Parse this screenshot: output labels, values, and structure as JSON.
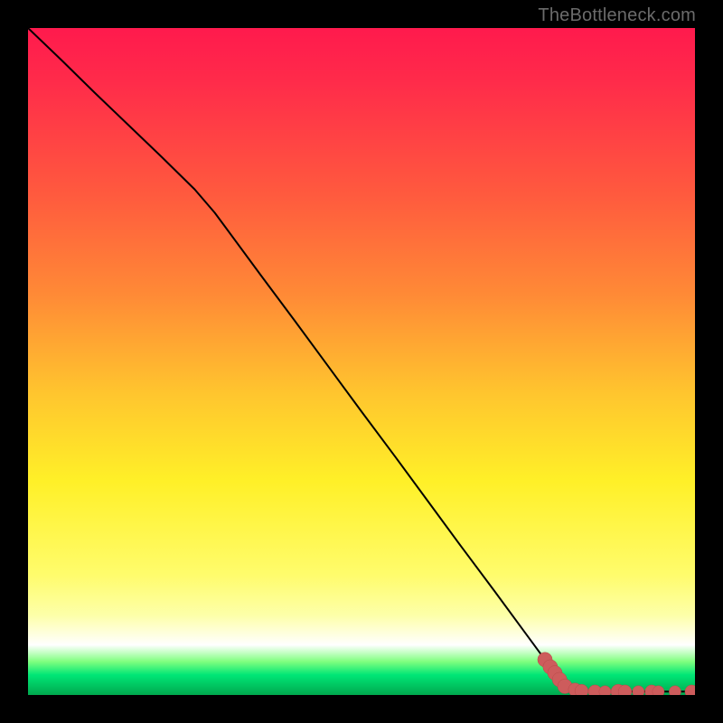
{
  "watermark": "TheBottleneck.com",
  "colors": {
    "line": "#000000",
    "marker": "#cd5c5c",
    "marker_stroke": "#b84a4a"
  },
  "chart_data": {
    "type": "line",
    "title": "",
    "xlabel": "",
    "ylabel": "",
    "xlim": [
      0,
      100
    ],
    "ylim": [
      0,
      100
    ],
    "grid": false,
    "background": "red-yellow-green vertical gradient",
    "series": [
      {
        "name": "curve",
        "x": [
          0,
          5,
          10,
          15,
          20,
          25,
          28,
          30,
          35,
          40,
          45,
          50,
          55,
          60,
          65,
          70,
          75,
          80,
          82,
          85,
          88,
          90,
          92,
          94,
          96,
          100
        ],
        "y": [
          100,
          95.2,
          90.3,
          85.5,
          80.7,
          75.8,
          72.3,
          69.6,
          62.8,
          56.1,
          49.3,
          42.5,
          35.8,
          29.0,
          22.2,
          15.5,
          8.7,
          1.9,
          0.8,
          0.5,
          0.5,
          0.5,
          0.5,
          0.5,
          0.5,
          0.5
        ]
      }
    ],
    "markers": [
      {
        "x": 77.5,
        "y": 5.3,
        "r": 1.1
      },
      {
        "x": 78.3,
        "y": 4.2,
        "r": 1.1
      },
      {
        "x": 79.0,
        "y": 3.3,
        "r": 1.1
      },
      {
        "x": 79.7,
        "y": 2.3,
        "r": 1.1
      },
      {
        "x": 80.5,
        "y": 1.3,
        "r": 1.1
      },
      {
        "x": 82.0,
        "y": 0.8,
        "r": 1.0
      },
      {
        "x": 83.0,
        "y": 0.6,
        "r": 1.0
      },
      {
        "x": 85.0,
        "y": 0.5,
        "r": 1.0
      },
      {
        "x": 86.5,
        "y": 0.5,
        "r": 0.9
      },
      {
        "x": 88.5,
        "y": 0.5,
        "r": 1.1
      },
      {
        "x": 89.5,
        "y": 0.5,
        "r": 1.0
      },
      {
        "x": 91.5,
        "y": 0.5,
        "r": 0.9
      },
      {
        "x": 93.5,
        "y": 0.5,
        "r": 1.0
      },
      {
        "x": 94.5,
        "y": 0.5,
        "r": 0.9
      },
      {
        "x": 97.0,
        "y": 0.5,
        "r": 0.9
      },
      {
        "x": 99.5,
        "y": 0.5,
        "r": 1.0
      }
    ]
  }
}
